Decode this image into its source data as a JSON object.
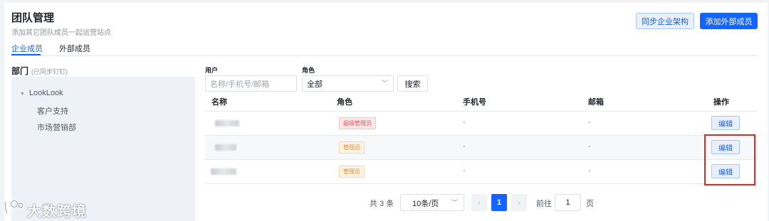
{
  "header": {
    "title": "团队管理",
    "subtitle": "添加其它团队成员一起运营站点",
    "sync_button": "同步企业架构",
    "add_button": "添加外部成员"
  },
  "tabs": [
    {
      "label": "企业成员",
      "active": true
    },
    {
      "label": "外部成员",
      "active": false
    }
  ],
  "department": {
    "title": "部门",
    "note": "(已同步钉钉)",
    "root": "LookLook",
    "children": [
      "客户支持",
      "市场营销部"
    ]
  },
  "filters": {
    "user_label": "用户",
    "user_placeholder": "名称/手机号/邮箱",
    "role_label": "角色",
    "role_value": "全部",
    "search_button": "搜索"
  },
  "table": {
    "columns": [
      "名称",
      "角色",
      "手机号",
      "邮箱",
      "操作"
    ],
    "rows": [
      {
        "role": "超级管理员",
        "role_color": "#e8505b",
        "phone": "-",
        "email": "-",
        "action": "编辑"
      },
      {
        "role": "管理员",
        "role_color": "#f08a24",
        "phone": "-",
        "email": "-",
        "action": "编辑"
      },
      {
        "role": "管理员",
        "role_color": "#f08a24",
        "phone": "-",
        "email": "-",
        "action": "编辑"
      }
    ]
  },
  "pagination": {
    "total_text": "共 3 条",
    "page_size": "10条/页",
    "current_page": "1",
    "goto_label": "前往",
    "goto_value": "1",
    "page_suffix": "页"
  },
  "watermark": {
    "text": "大数跨境"
  },
  "colors": {
    "primary": "#1664ff",
    "highlight": "#e02828"
  }
}
